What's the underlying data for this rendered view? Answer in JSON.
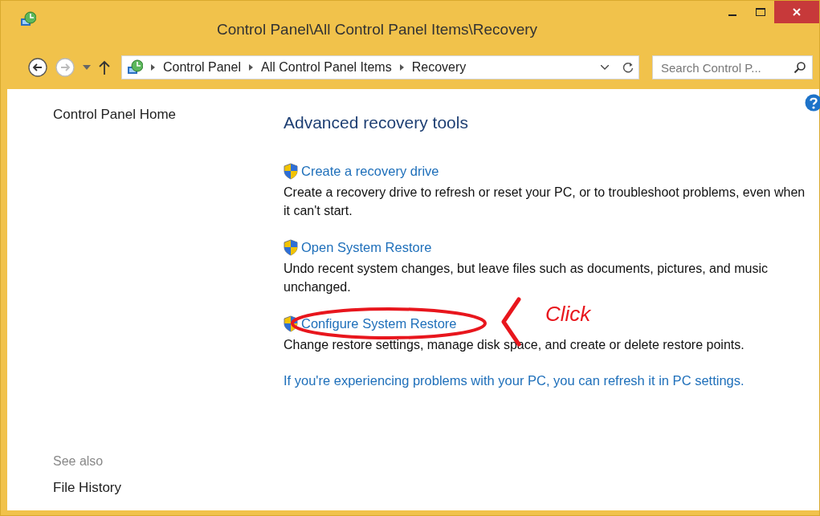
{
  "window": {
    "title": "Control Panel\\All Control Panel Items\\Recovery"
  },
  "address_bar": {
    "crumbs": [
      "Control Panel",
      "All Control Panel Items",
      "Recovery"
    ]
  },
  "search": {
    "placeholder": "Search Control P..."
  },
  "sidebar": {
    "items": [
      "Control Panel Home"
    ],
    "see_also_heading": "See also",
    "see_also": [
      "File History"
    ]
  },
  "content": {
    "heading": "Advanced recovery tools",
    "tasks": [
      {
        "link": "Create a recovery drive",
        "description": "Create a recovery drive to refresh or reset your PC, or to troubleshoot problems, even when it can't start.",
        "circled": false
      },
      {
        "link": "Open System Restore",
        "description": "Undo recent system changes, but leave files such as documents, pictures, and music unchanged.",
        "circled": false
      },
      {
        "link": "Configure System Restore",
        "description": "Change restore settings, manage disk space, and create or delete restore points.",
        "circled": true
      }
    ],
    "footer_link": "If you're experiencing problems with your PC, you can refresh it in PC settings."
  },
  "annotation": {
    "label": "Click"
  }
}
